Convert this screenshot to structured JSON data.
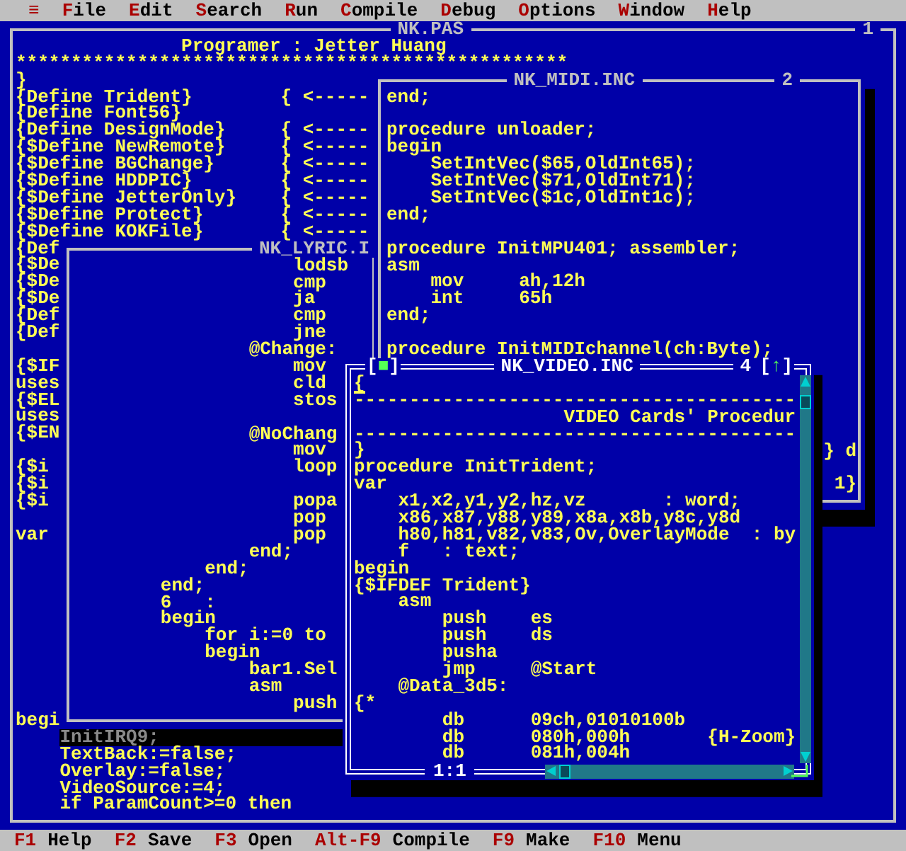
{
  "menu": [
    {
      "label": "≡"
    },
    {
      "label": "File"
    },
    {
      "label": "Edit"
    },
    {
      "label": "Search"
    },
    {
      "label": "Run"
    },
    {
      "label": "Compile"
    },
    {
      "label": "Debug"
    },
    {
      "label": "Options"
    },
    {
      "label": "Window"
    },
    {
      "label": "Help"
    }
  ],
  "windows": [
    {
      "title": "NK.PAS",
      "number": "1",
      "active": false,
      "blocks": [
        [
          "               Programer : Jetter Huang",
          "**************************************************",
          "}",
          "{Define Trident}        { <-----",
          "{Define Font56}",
          "{Define DesignMode}     { <-----",
          "{$Define NewRemote}     { <-----",
          "{$Define BGChange}      { <-----",
          "{$Define HDDPIC}        { <-----",
          "{$Define JetterOnly}    { <-----",
          "{$Define Protect}       { <-----",
          "{$Define KOKFile}       { <-----",
          "{Def",
          "{$De",
          "{$De",
          "{$De",
          "{Def",
          "{Def"
        ],
        [
          "{$IF",
          "uses",
          "{$EL",
          "uses",
          "{$EN"
        ],
        [
          "{$i",
          "{$i",
          "{$i"
        ],
        [
          "var"
        ]
      ],
      "bottom_lines": [
        {
          "text": "begi",
          "highlighted": false
        },
        {
          "text": "    InitIRQ9;",
          "highlighted": true
        },
        {
          "text": "    TextBack:=false;",
          "highlighted": false
        },
        {
          "text": "    Overlay:=false;",
          "highlighted": false
        },
        {
          "text": "    VideoSource:=4;",
          "highlighted": false
        },
        {
          "text": "    if ParamCount>=0 then",
          "highlighted": false
        }
      ]
    },
    {
      "title": "NK_LYRIC.I",
      "active": false,
      "blocks": [
        [
          "                    lodsb",
          "                    cmp",
          "                    ja",
          "                    cmp",
          "                    jne",
          "                @Change:",
          "                    mov",
          "                    cld",
          "                    stos"
        ],
        [
          "                @NoChang",
          "                    mov",
          "                    loop"
        ],
        [
          "                    popa",
          "                    pop",
          "                    pop",
          "                end;",
          "            end;",
          "        end;",
          "        6   :",
          "        begin",
          "            for i:=0 to",
          "            begin",
          "                bar1.Sel",
          "                asm",
          "                    push"
        ]
      ]
    },
    {
      "title": "NK_MIDI.INC",
      "number": "2",
      "active": false,
      "blocks": [
        [
          "end;"
        ],
        [
          "procedure unloader;",
          "begin",
          "    SetIntVec($65,OldInt65);",
          "    SetIntVec($71,OldInt71);",
          "    SetIntVec($1c,OldInt1c);",
          "end;"
        ],
        [
          "procedure InitMPU401; assembler;",
          "asm",
          "    mov     ah,12h",
          "    int     65h",
          "end;"
        ],
        [
          "procedure InitMIDIchannel(ch:Byte);"
        ]
      ],
      "bottom_blocks": [
        [
          "} d"
        ],
        [
          "1}"
        ]
      ]
    },
    {
      "title": "NK_VIDEO.INC",
      "number": "4",
      "active": true,
      "close_button": "[■]",
      "zoom_button": "[↑]",
      "position": "1:1",
      "cursor": true,
      "blocks": [
        [
          "{",
          "----------------------------------------",
          "                   VIDEO Cards' Procedur",
          "----------------------------------------",
          "}",
          "procedure InitTrident;",
          "var",
          "    x1,x2,y1,y2,hz,vz       : word;",
          "    x86,x87,y88,y89,x8a,x8b,y8c,y8d",
          "    h80,h81,v82,v83,Ov,OverlayMode  : by",
          "    f   : text;",
          "begin",
          "{$IFDEF Trident}",
          "    asm",
          "        push    es",
          "        push    ds",
          "        pusha",
          "        jmp     @Start",
          "    @Data_3d5:",
          "{*",
          "        db      09ch,01010100b",
          "        db      080h,000h       {H-Zoom}",
          "        db      081h,004h"
        ]
      ]
    }
  ],
  "status_bar": [
    {
      "key": "F1",
      "label": "Help"
    },
    {
      "key": "F2",
      "label": "Save"
    },
    {
      "key": "F3",
      "label": "Open"
    },
    {
      "key": "Alt-F9",
      "label": "Compile"
    },
    {
      "key": "F9",
      "label": "Make"
    },
    {
      "key": "F10",
      "label": "Menu"
    }
  ]
}
